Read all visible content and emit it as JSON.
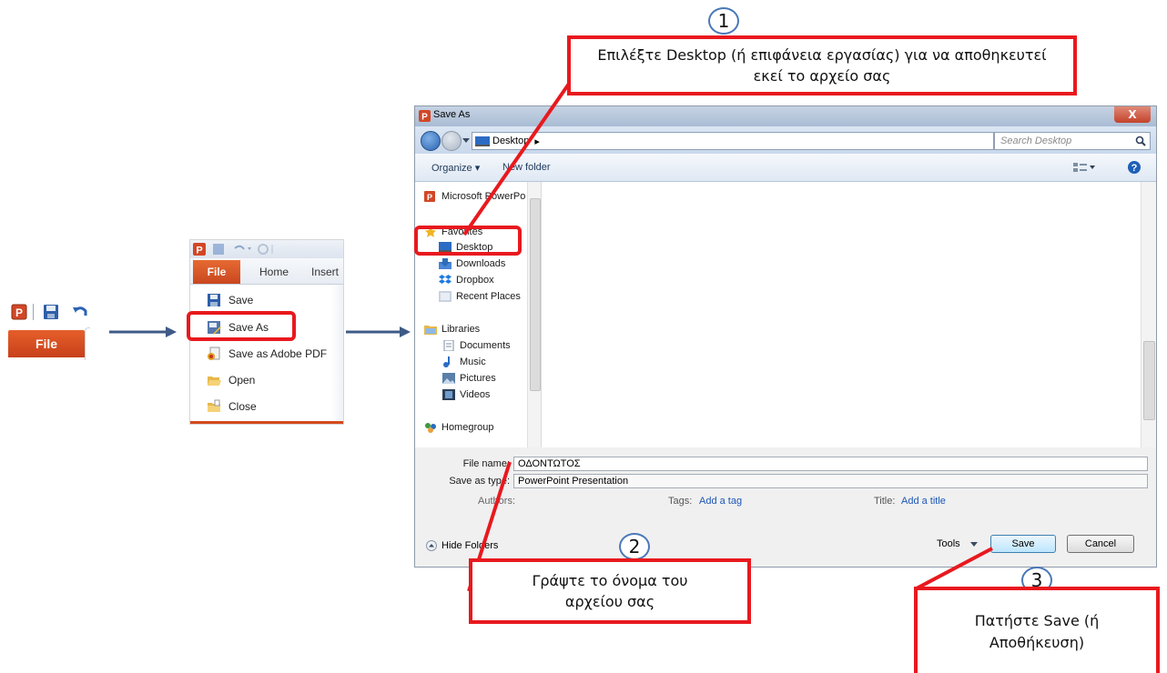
{
  "panel1": {
    "file_tab": "File",
    "icons": [
      "powerpoint-app-icon",
      "save-icon",
      "undo-icon"
    ]
  },
  "panel2": {
    "tabs": {
      "file": "File",
      "home": "Home",
      "insert": "Insert"
    },
    "menu_items": [
      {
        "label": "Save",
        "icon": "save-icon"
      },
      {
        "label": "Save As",
        "icon": "save-as-icon"
      },
      {
        "label": "Save as Adobe PDF",
        "icon": "pdf-icon"
      },
      {
        "label": "Open",
        "icon": "open-folder-icon"
      },
      {
        "label": "Close",
        "icon": "close-folder-icon"
      }
    ]
  },
  "dialog": {
    "title": "Save As",
    "close_glyph": "X",
    "address": "Desktop",
    "address_sep": "▸",
    "search_placeholder": "Search Desktop",
    "toolbar": {
      "organize": "Organize ▾",
      "new_folder": "New folder"
    },
    "nav": {
      "items": [
        {
          "label": "Microsoft PowerPo",
          "icon": "powerpoint-app-icon"
        },
        {
          "label": "Favorites",
          "icon": "star-icon"
        },
        {
          "label": "Desktop",
          "icon": "desktop-icon"
        },
        {
          "label": "Downloads",
          "icon": "downloads-icon"
        },
        {
          "label": "Dropbox",
          "icon": "dropbox-icon"
        },
        {
          "label": "Recent Places",
          "icon": "recent-places-icon"
        },
        {
          "label": "Libraries",
          "icon": "libraries-icon"
        },
        {
          "label": "Documents",
          "icon": "documents-icon"
        },
        {
          "label": "Music",
          "icon": "music-icon"
        },
        {
          "label": "Pictures",
          "icon": "pictures-icon"
        },
        {
          "label": "Videos",
          "icon": "videos-icon"
        },
        {
          "label": "Homegroup",
          "icon": "homegroup-icon"
        }
      ]
    },
    "filename_label": "File name:",
    "filename_value": "ΟΔΟΝΤΩΤΟΣ",
    "savetype_label": "Save as type:",
    "savetype_value": "PowerPoint Presentation",
    "authors_label": "Authors:",
    "tags_label": "Tags:",
    "tags_link": "Add a tag",
    "title_label": "Title:",
    "title_link": "Add a title",
    "hide_folders": "Hide Folders",
    "tools": "Tools",
    "save_button": "Save",
    "cancel_button": "Cancel"
  },
  "annotations": {
    "step1": {
      "number": "1",
      "text": "Επιλέξτε Desktop (ή επιφάνεια εργασίας) για να αποθηκευτεί εκεί το αρχείο σας"
    },
    "step2": {
      "number": "2",
      "text": "Γράψτε το όνομα του αρχείου σας"
    },
    "step3": {
      "number": "3",
      "text": "Πατήστε Save (ή Αποθήκευση)"
    }
  },
  "colors": {
    "highlight": "#e8191e",
    "file_tab": "#d8521f",
    "arrow": "#3e5a86",
    "step_circle": "#4a78b8"
  }
}
